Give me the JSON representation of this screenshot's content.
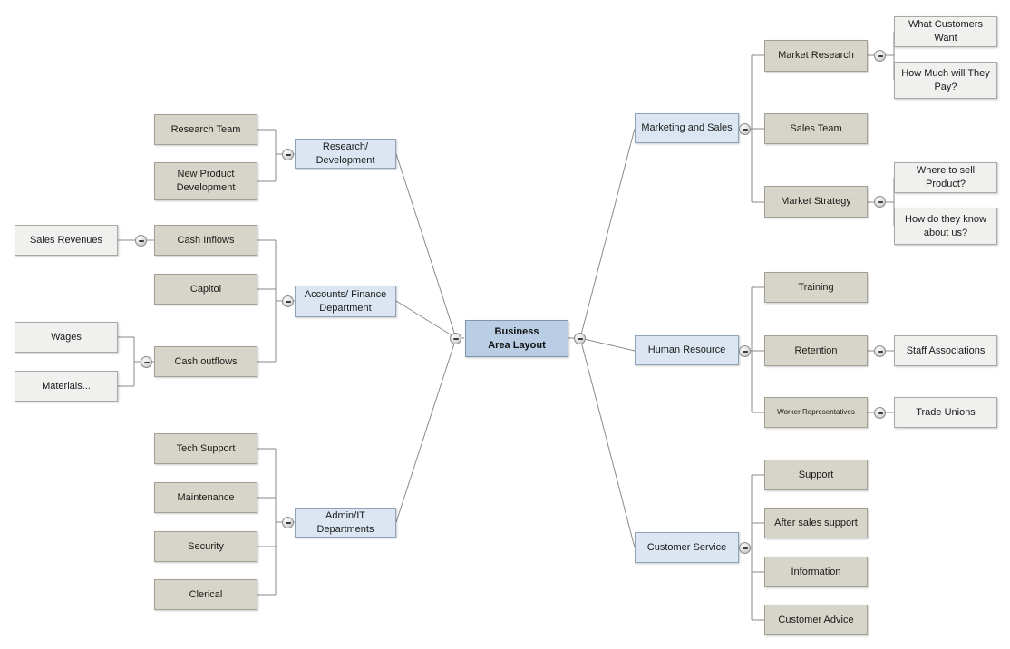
{
  "diagram": {
    "title": "Business Area Layout",
    "type": "mind-map",
    "colors": {
      "root_fill": "#b9cde4",
      "branch_fill": "#dce6f2",
      "tan_fill": "#d7d4c9",
      "gray_fill": "#f0f0ef",
      "line": "#8a8a8a",
      "text": "#1a1a1a"
    },
    "root": {
      "label": "Business\nArea Layout",
      "line1": "Business",
      "line2": "Area Layout"
    },
    "left_branches": [
      {
        "label": "Research/ Development",
        "children": [
          {
            "label": "Research Team"
          },
          {
            "label": "New Product Development",
            "line1": "New Product",
            "line2": "Development"
          }
        ]
      },
      {
        "label": "Accounts/ Finance Department",
        "line1": "Accounts/ Finance",
        "line2": "Department",
        "children": [
          {
            "label": "Cash Inflows",
            "children": [
              {
                "label": "Sales Revenues"
              }
            ]
          },
          {
            "label": "Capitol"
          },
          {
            "label": "Cash outflows",
            "children": [
              {
                "label": "Wages"
              },
              {
                "label": "Materials..."
              }
            ]
          }
        ]
      },
      {
        "label": "Admin/IT Departments",
        "children": [
          {
            "label": "Tech Support"
          },
          {
            "label": "Maintenance"
          },
          {
            "label": "Security"
          },
          {
            "label": "Clerical"
          }
        ]
      }
    ],
    "right_branches": [
      {
        "label": "Marketing and Sales",
        "children": [
          {
            "label": "Market Research",
            "children": [
              {
                "label": "What Customers Want"
              },
              {
                "label": "How Much will They Pay?",
                "line1": "How Much will They",
                "line2": "Pay?"
              }
            ]
          },
          {
            "label": "Sales Team"
          },
          {
            "label": "Market Strategy",
            "children": [
              {
                "label": "Where to sell Product?"
              },
              {
                "label": "How do they know about us?",
                "line1": "How do they know",
                "line2": "about us?"
              }
            ]
          }
        ]
      },
      {
        "label": "Human Resource",
        "children": [
          {
            "label": "Training"
          },
          {
            "label": "Retention",
            "children": [
              {
                "label": "Staff Associations"
              }
            ]
          },
          {
            "label": "Worker Representatives",
            "children": [
              {
                "label": "Trade Unions"
              }
            ]
          }
        ]
      },
      {
        "label": "Customer Service",
        "children": [
          {
            "label": "Support"
          },
          {
            "label": "After sales support"
          },
          {
            "label": "Information"
          },
          {
            "label": "Customer Advice"
          }
        ]
      }
    ]
  }
}
